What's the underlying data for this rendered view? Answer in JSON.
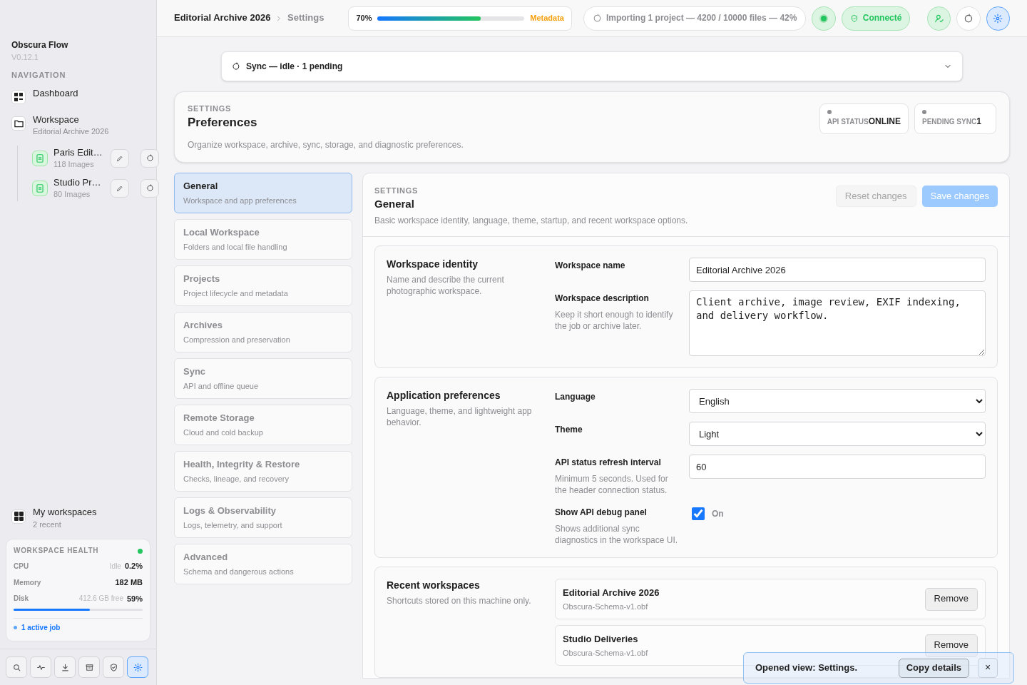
{
  "sidebar": {
    "app_name": "Obscura Flow",
    "version": "V0.12.1",
    "nav_heading": "NAVIGATION",
    "nav_items": [
      {
        "kind": "dashboard",
        "label": "Dashboard"
      },
      {
        "kind": "folder",
        "label": "Workspace",
        "sublabel": "Editorial Archive 2026",
        "children": [
          {
            "label": "Paris Edit…",
            "sublabel": "118 Images"
          },
          {
            "label": "Studio Pr…",
            "sublabel": "80 Images"
          }
        ]
      }
    ],
    "my_workspaces": {
      "label": "My workspaces",
      "sublabel": "2 recent"
    },
    "health": {
      "title": "WORKSPACE HEALTH",
      "rows": [
        {
          "label": "CPU",
          "note": "Idle",
          "value": "0.2%"
        },
        {
          "label": "Memory",
          "value": "182 MB"
        },
        {
          "label": "Disk",
          "note": "412.6 GB free",
          "value": "59%",
          "level": 0.59
        }
      ],
      "active_jobs": "1 active job"
    },
    "toolbar": [
      {
        "kind": "search",
        "selected": false
      },
      {
        "kind": "activity",
        "selected": false
      },
      {
        "kind": "download",
        "selected": false
      },
      {
        "kind": "archive",
        "selected": false
      },
      {
        "kind": "shield",
        "selected": false
      },
      {
        "kind": "settings",
        "selected": true
      }
    ]
  },
  "topbar": {
    "breadcrumb": [
      "Editorial Archive 2026",
      "Settings"
    ],
    "progress": {
      "percent": "70%",
      "level": 0.7,
      "label": "Metadata"
    },
    "import_status": "Importing 1 project — 4200 / 10000 files — 42%",
    "connection": "Connecté",
    "actions": [
      {
        "kind": "user",
        "selected": false
      },
      {
        "kind": "refresh",
        "selected": false
      },
      {
        "kind": "settings",
        "selected": true
      }
    ]
  },
  "sync_bar": {
    "text": "Sync — idle · 1 pending",
    "expanded": false
  },
  "preferences": {
    "eyebrow": "SETTINGS",
    "title": "Preferences",
    "description": "Organize workspace, archive, sync, storage, and diagnostic preferences.",
    "badges": [
      {
        "label": "API STATUS",
        "value": "ONLINE"
      },
      {
        "label": "PENDING SYNC",
        "value": "1"
      }
    ]
  },
  "settings_nav": [
    {
      "title": "General",
      "subtitle": "Workspace and app preferences",
      "selected": true
    },
    {
      "title": "Local Workspace",
      "subtitle": "Folders and local file handling",
      "selected": false
    },
    {
      "title": "Projects",
      "subtitle": "Project lifecycle and metadata",
      "selected": false
    },
    {
      "title": "Archives",
      "subtitle": "Compression and preservation",
      "selected": false
    },
    {
      "title": "Sync",
      "subtitle": "API and offline queue",
      "selected": false
    },
    {
      "title": "Remote Storage",
      "subtitle": "Cloud and cold backup",
      "selected": false
    },
    {
      "title": "Health, Integrity & Restore",
      "subtitle": "Checks, lineage, and recovery",
      "selected": false
    },
    {
      "title": "Logs & Observability",
      "subtitle": "Logs, telemetry, and support",
      "selected": false
    },
    {
      "title": "Advanced",
      "subtitle": "Schema and dangerous actions",
      "selected": false
    }
  ],
  "panel": {
    "eyebrow": "SETTINGS",
    "title": "General",
    "description": "Basic workspace identity, language, theme, startup, and recent workspace options.",
    "reset_button": {
      "label": "Reset changes",
      "disabled": true
    },
    "save_button": {
      "label": "Save changes",
      "disabled": true
    },
    "sections": [
      {
        "kind": "form",
        "title": "Workspace identity",
        "description": "Name and describe the current photographic workspace.",
        "fields": [
          {
            "kind": "text",
            "label": "Workspace name",
            "value": "Editorial Archive 2026"
          },
          {
            "kind": "textarea",
            "label": "Workspace description",
            "hint": "Keep it short enough to identify the job or archive later.",
            "value": "Client archive, image review, EXIF indexing, and delivery workflow."
          }
        ]
      },
      {
        "kind": "form",
        "title": "Application preferences",
        "description": "Language, theme, and lightweight app behavior.",
        "fields": [
          {
            "kind": "select",
            "label": "Language",
            "value": "English"
          },
          {
            "kind": "select",
            "label": "Theme",
            "value": "Light"
          },
          {
            "kind": "text",
            "label": "API status refresh interval",
            "hint": "Minimum 5 seconds. Used for the header connection status.",
            "value": "60"
          },
          {
            "kind": "checkbox",
            "label": "Show API debug panel",
            "hint": "Shows additional sync diagnostics in the workspace UI.",
            "checked": true,
            "value": "On"
          }
        ]
      },
      {
        "kind": "recent",
        "title": "Recent workspaces",
        "description": "Shortcuts stored on this machine only.",
        "items": [
          {
            "name": "Editorial Archive 2026",
            "file": "Obscura-Schema-v1.obf",
            "action": "Remove"
          },
          {
            "name": "Studio Deliveries",
            "file": "Obscura-Schema-v1.obf",
            "action": "Remove"
          }
        ]
      }
    ]
  },
  "toast": {
    "message": "Opened view: Settings.",
    "action": "Copy details",
    "close": "×"
  }
}
